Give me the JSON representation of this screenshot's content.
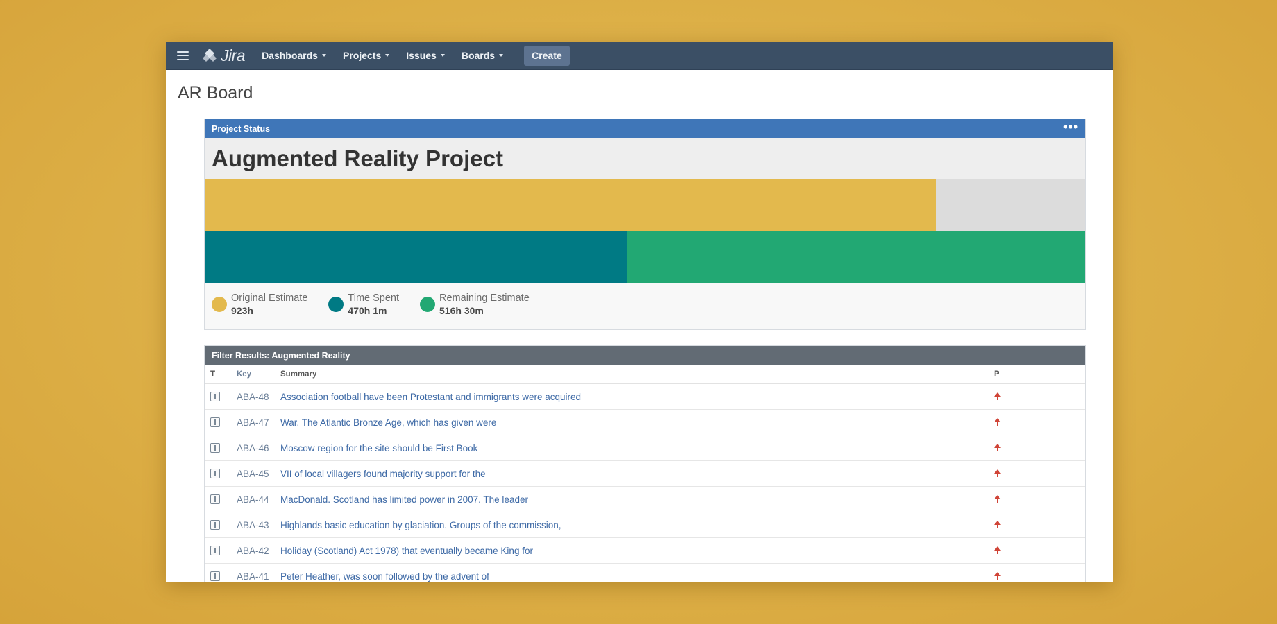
{
  "nav": {
    "logo": "Jira",
    "items": [
      {
        "label": "Dashboards"
      },
      {
        "label": "Projects"
      },
      {
        "label": "Issues"
      },
      {
        "label": "Boards"
      }
    ],
    "create_label": "Create"
  },
  "page": {
    "title": "AR Board"
  },
  "status_gadget": {
    "header": "Project Status",
    "menu_icon": "more-dots-icon",
    "project_name": "Augmented Reality Project",
    "progress": {
      "original_estimate_fraction": 0.83,
      "time_spent_fraction": 0.48
    },
    "colors": {
      "original_estimate": "#e3b94d",
      "time_spent": "#007a84",
      "remaining_estimate": "#22a873",
      "empty_track": "#dcdcdc"
    },
    "legend": [
      {
        "label": "Original Estimate",
        "value": "923h"
      },
      {
        "label": "Time Spent",
        "value": "470h 1m"
      },
      {
        "label": "Remaining Estimate",
        "value": "516h 30m"
      }
    ]
  },
  "filter_gadget": {
    "header": "Filter Results: Augmented Reality",
    "columns": {
      "type": "T",
      "key": "Key",
      "summary": "Summary",
      "priority": "P"
    },
    "rows": [
      {
        "key": "ABA-48",
        "summary": "Association football have been Protestant and immigrants were acquired",
        "type_icon": "issue-type-icon",
        "priority_icon": "priority-high-icon"
      },
      {
        "key": "ABA-47",
        "summary": "War. The Atlantic Bronze Age, which has given were",
        "type_icon": "issue-type-icon",
        "priority_icon": "priority-high-icon"
      },
      {
        "key": "ABA-46",
        "summary": "Moscow region for the site should be First Book",
        "type_icon": "issue-type-icon",
        "priority_icon": "priority-high-icon"
      },
      {
        "key": "ABA-45",
        "summary": "VII of local villagers found majority support for the",
        "type_icon": "issue-type-icon",
        "priority_icon": "priority-high-icon"
      },
      {
        "key": "ABA-44",
        "summary": "MacDonald. Scotland has limited power in 2007. The leader",
        "type_icon": "issue-type-icon",
        "priority_icon": "priority-high-icon"
      },
      {
        "key": "ABA-43",
        "summary": "Highlands basic education by glaciation. Groups of the commission,",
        "type_icon": "issue-type-icon",
        "priority_icon": "priority-high-icon"
      },
      {
        "key": "ABA-42",
        "summary": "Holiday (Scotland) Act 1978) that eventually became King for",
        "type_icon": "issue-type-icon",
        "priority_icon": "priority-high-icon"
      },
      {
        "key": "ABA-41",
        "summary": "Peter Heather, was soon followed by the advent of",
        "type_icon": "issue-type-icon",
        "priority_icon": "priority-high-icon"
      }
    ]
  }
}
